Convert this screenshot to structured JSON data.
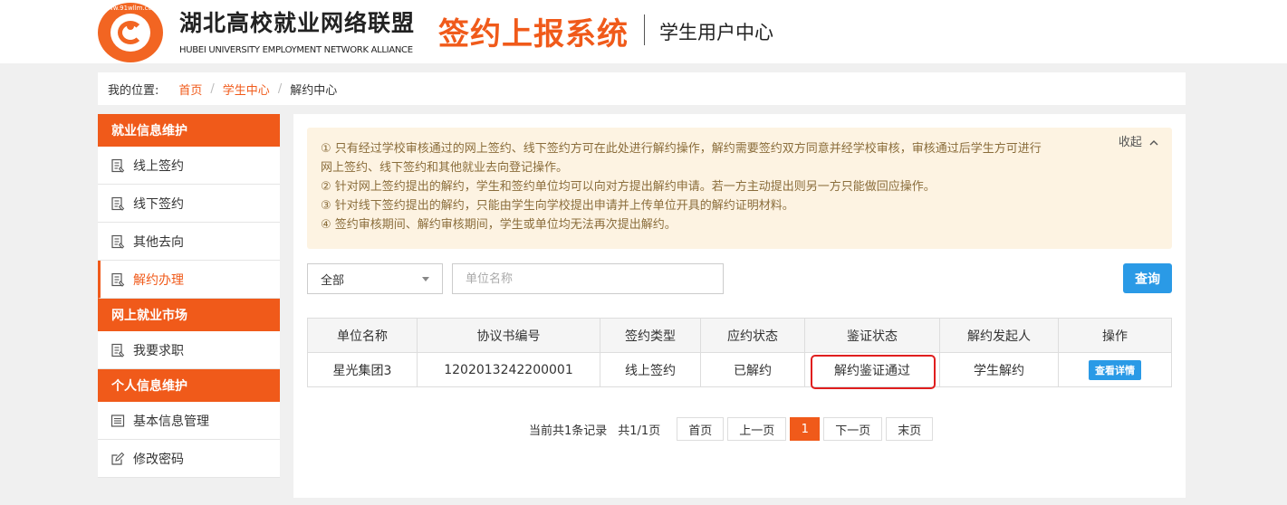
{
  "header": {
    "logo_ring_text": "www.91wllm.com",
    "brand_cn": "湖北高校就业网络联盟",
    "brand_en": "HUBEI UNIVERSITY EMPLOYMENT NETWORK ALLIANCE",
    "system_title": "签约上报系统",
    "user_center": "学生用户中心"
  },
  "breadcrumb": {
    "label": "我的位置:",
    "home": "首页",
    "student_center": "学生中心",
    "current": "解约中心"
  },
  "sidebar": {
    "groups": [
      {
        "title": "就业信息维护",
        "items": [
          {
            "label": "线上签约",
            "icon": "document-list-icon"
          },
          {
            "label": "线下签约",
            "icon": "document-list-icon"
          },
          {
            "label": "其他去向",
            "icon": "document-list-icon"
          },
          {
            "label": "解约办理",
            "icon": "document-list-icon",
            "active": true
          }
        ]
      },
      {
        "title": "网上就业市场",
        "items": [
          {
            "label": "我要求职",
            "icon": "document-list-icon"
          }
        ]
      },
      {
        "title": "个人信息维护",
        "items": [
          {
            "label": "基本信息管理",
            "icon": "profile-card-icon"
          },
          {
            "label": "修改密码",
            "icon": "edit-pencil-icon"
          }
        ]
      }
    ]
  },
  "notice": {
    "collapse_label": "收起",
    "lines": [
      "① 只有经过学校审核通过的网上签约、线下签约方可在此处进行解约操作，解约需要签约双方同意并经学校审核，审核通过后学生方可进行",
      "网上签约、线下签约和其他就业去向登记操作。",
      "② 针对网上签约提出的解约，学生和签约单位均可以向对方提出解约申请。若一方主动提出则另一方只能做回应操作。",
      "③ 针对线下签约提出的解约，只能由学生向学校提出申请并上传单位开具的解约证明材料。",
      "④ 签约审核期间、解约审核期间，学生或单位均无法再次提出解约。"
    ]
  },
  "filter": {
    "select_value": "全部",
    "input_placeholder": "单位名称",
    "query_label": "查询"
  },
  "table": {
    "headers": [
      "单位名称",
      "协议书编号",
      "签约类型",
      "应约状态",
      "鉴证状态",
      "解约发起人",
      "操作"
    ],
    "rows": [
      {
        "company": "星光集团3",
        "agreement_no": "1202013242200001",
        "sign_type": "线上签约",
        "response_status": "已解约",
        "verify_status": "解约鉴证通过",
        "initiator": "学生解约",
        "action": "查看详情"
      }
    ]
  },
  "pager": {
    "total_text": "当前共1条记录",
    "pages_text": "共1/1页",
    "first": "首页",
    "prev": "上一页",
    "current": "1",
    "next": "下一页",
    "last": "末页"
  },
  "colors": {
    "accent": "#f05a1a",
    "primary_button": "#2a9ae6",
    "notice_bg": "#fdf3e2",
    "notice_text": "#8a6d3b",
    "success": "#1a8a1a",
    "highlight": "#e01e1e"
  }
}
